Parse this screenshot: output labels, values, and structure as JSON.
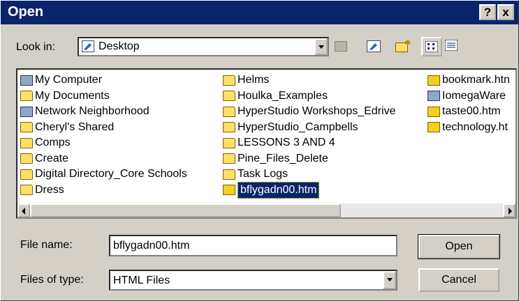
{
  "dialog": {
    "title": "Open",
    "help_label": "?",
    "close_label": "x"
  },
  "lookin": {
    "label": "Look in:",
    "value": "Desktop"
  },
  "files": {
    "col1": [
      {
        "name": "My Computer",
        "icon": "computer-icon"
      },
      {
        "name": "My Documents",
        "icon": "folder-icon"
      },
      {
        "name": "Network Neighborhood",
        "icon": "network-icon"
      },
      {
        "name": "Cheryl's Shared",
        "icon": "shared-folder-icon"
      },
      {
        "name": "Comps",
        "icon": "folder-icon"
      },
      {
        "name": "Create",
        "icon": "folder-icon"
      },
      {
        "name": "Digital Directory_Core Schools",
        "icon": "folder-icon"
      },
      {
        "name": "Dress",
        "icon": "folder-icon"
      }
    ],
    "col2": [
      {
        "name": "Helms",
        "icon": "folder-icon"
      },
      {
        "name": "Houlka_Examples",
        "icon": "folder-icon"
      },
      {
        "name": "HyperStudio Workshops_Edrive",
        "icon": "folder-icon"
      },
      {
        "name": "HyperStudio_Campbells",
        "icon": "folder-icon"
      },
      {
        "name": "LESSONS 3 AND 4",
        "icon": "folder-icon"
      },
      {
        "name": "Pine_Files_Delete",
        "icon": "folder-icon"
      },
      {
        "name": "Task Logs",
        "icon": "folder-icon"
      },
      {
        "name": "bflygadn00.htm",
        "icon": "html-file-icon",
        "selected": true
      }
    ],
    "col3": [
      {
        "name": "bookmark.htn",
        "icon": "html-file-icon"
      },
      {
        "name": "IomegaWare",
        "icon": "program-icon"
      },
      {
        "name": "taste00.htm",
        "icon": "html-file-icon"
      },
      {
        "name": "technology.ht",
        "icon": "html-file-icon"
      }
    ]
  },
  "filename": {
    "label": "File name:",
    "value": "bflygadn00.htm"
  },
  "filetype": {
    "label": "Files of type:",
    "value": "HTML Files"
  },
  "buttons": {
    "open": "Open",
    "cancel": "Cancel"
  }
}
